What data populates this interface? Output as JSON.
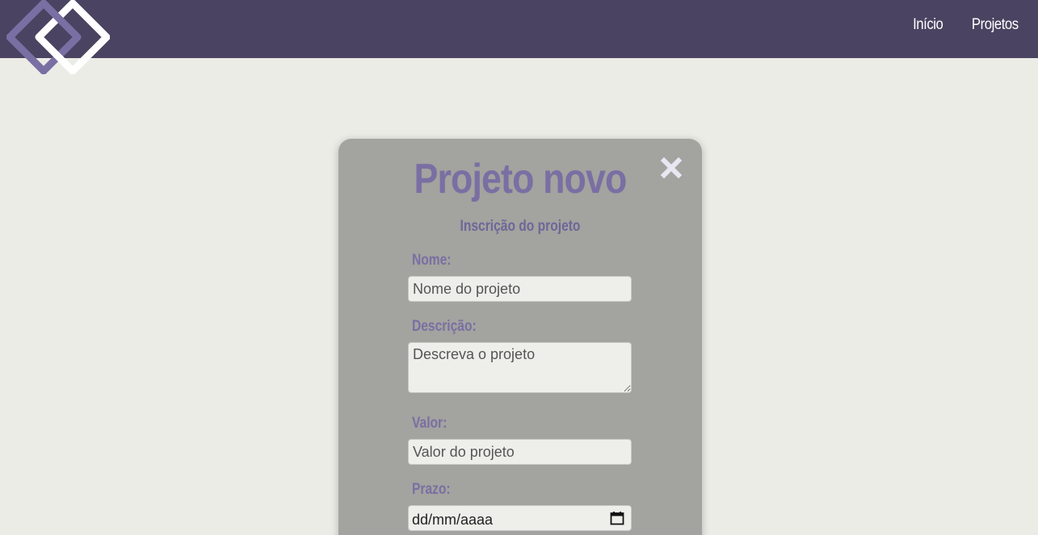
{
  "nav": {
    "links": [
      "Início",
      "Projetos"
    ]
  },
  "form": {
    "title": "Projeto novo",
    "subtitle": "Inscrição do projeto",
    "fields": {
      "name": {
        "label": "Nome:",
        "placeholder": "Nome do projeto"
      },
      "description": {
        "label": "Descrição:",
        "placeholder": "Descreva o projeto"
      },
      "value": {
        "label": "Valor:",
        "placeholder": "Valor do projeto"
      },
      "deadline": {
        "label": "Prazo:",
        "placeholder": "dd/mm/aaaa"
      }
    }
  },
  "colors": {
    "navbar": "#4a4361",
    "background": "#ecece7",
    "card": "#a3a39f",
    "accent": "#7a6fa3"
  },
  "icons": {
    "logo": "diamond-chain-logo",
    "close": "close-icon",
    "calendar": "calendar-icon"
  }
}
